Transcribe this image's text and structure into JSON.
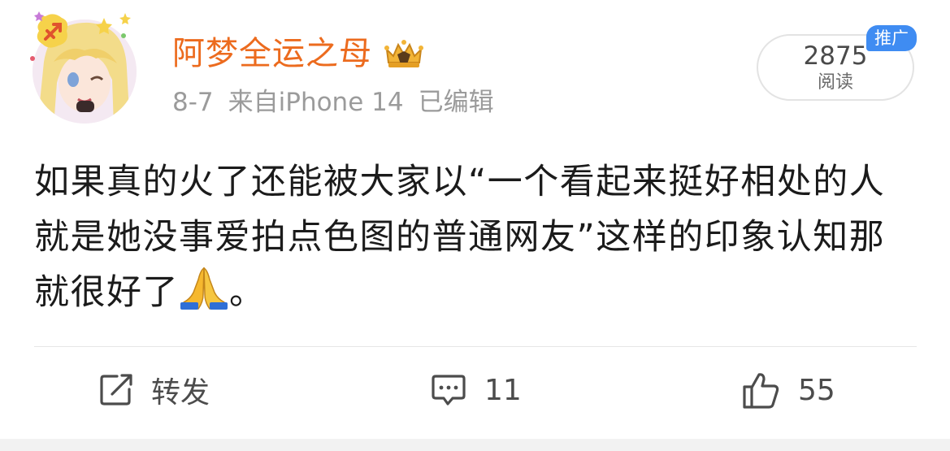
{
  "user": {
    "name": "阿梦全运之母",
    "avatar_icon": "anime-girl-avatar-icon",
    "badge_icon": "vip-crown-icon"
  },
  "meta": {
    "date": "8-7",
    "source": "来自iPhone 14",
    "edited": "已编辑"
  },
  "stats": {
    "read_count": "2875",
    "read_label": "阅读",
    "promo_label": "推广"
  },
  "post": {
    "text": "如果真的火了还能被大家以“一个看起来挺好相处的人就是她没事爱拍点色图的普通网友”这样的印象认知那就很好了",
    "emoji_icon": "folded-hands-emoji",
    "text_end": "。"
  },
  "actions": {
    "repost_label": "转发",
    "comment_count": "11",
    "like_count": "55"
  },
  "colors": {
    "username": "#ec6b1e",
    "promo": "#3f8cf2",
    "meta": "#9b9b9b",
    "text": "#1b1b1b"
  }
}
